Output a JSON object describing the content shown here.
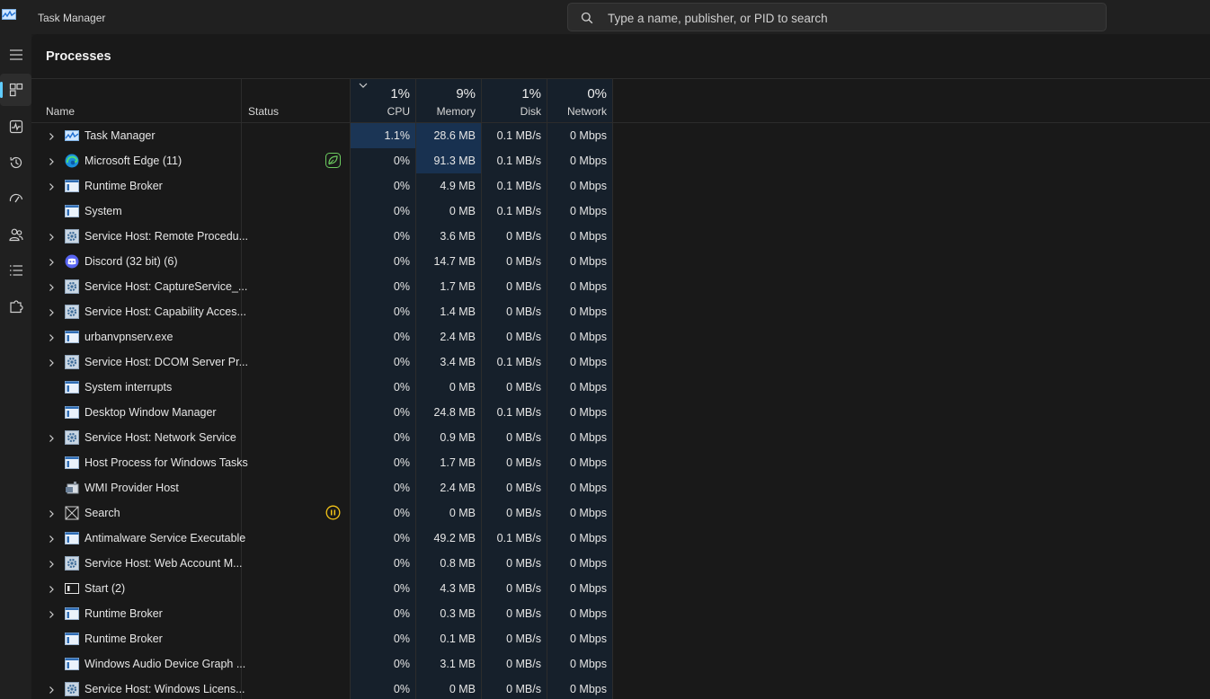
{
  "app": {
    "title": "Task Manager"
  },
  "search": {
    "placeholder": "Type a name, publisher, or PID to search"
  },
  "page": {
    "title": "Processes"
  },
  "columns": {
    "name": "Name",
    "status": "Status",
    "cpu": {
      "label": "CPU",
      "total": "1%"
    },
    "memory": {
      "label": "Memory",
      "total": "9%"
    },
    "disk": {
      "label": "Disk",
      "total": "1%"
    },
    "network": {
      "label": "Network",
      "total": "0%"
    }
  },
  "colors": {
    "accent": "#60cdff",
    "efficiency": "#6ccb5f",
    "paused": "#f5c518"
  },
  "processes": [
    {
      "name": "Task Manager",
      "icon": "task-manager-icon",
      "expandable": true,
      "status": "",
      "cpu": "1.1%",
      "memory": "28.6 MB",
      "disk": "0.1 MB/s",
      "network": "0 Mbps"
    },
    {
      "name": "Microsoft Edge (11)",
      "icon": "edge-icon",
      "expandable": true,
      "status": "efficiency-mode-icon",
      "cpu": "0%",
      "memory": "91.3 MB",
      "disk": "0.1 MB/s",
      "network": "0 Mbps"
    },
    {
      "name": "Runtime Broker",
      "icon": "window-app-icon",
      "expandable": true,
      "status": "",
      "cpu": "0%",
      "memory": "4.9 MB",
      "disk": "0.1 MB/s",
      "network": "0 Mbps"
    },
    {
      "name": "System",
      "icon": "window-app-icon",
      "expandable": false,
      "status": "",
      "cpu": "0%",
      "memory": "0 MB",
      "disk": "0.1 MB/s",
      "network": "0 Mbps"
    },
    {
      "name": "Service Host: Remote Procedu...",
      "icon": "service-gear-icon",
      "expandable": true,
      "status": "",
      "cpu": "0%",
      "memory": "3.6 MB",
      "disk": "0 MB/s",
      "network": "0 Mbps"
    },
    {
      "name": "Discord (32 bit) (6)",
      "icon": "discord-icon",
      "expandable": true,
      "status": "",
      "cpu": "0%",
      "memory": "14.7 MB",
      "disk": "0 MB/s",
      "network": "0 Mbps"
    },
    {
      "name": "Service Host: CaptureService_...",
      "icon": "service-gear-icon",
      "expandable": true,
      "status": "",
      "cpu": "0%",
      "memory": "1.7 MB",
      "disk": "0 MB/s",
      "network": "0 Mbps"
    },
    {
      "name": "Service Host: Capability Acces...",
      "icon": "service-gear-icon",
      "expandable": true,
      "status": "",
      "cpu": "0%",
      "memory": "1.4 MB",
      "disk": "0 MB/s",
      "network": "0 Mbps"
    },
    {
      "name": "urbanvpnserv.exe",
      "icon": "window-app-icon",
      "expandable": true,
      "status": "",
      "cpu": "0%",
      "memory": "2.4 MB",
      "disk": "0 MB/s",
      "network": "0 Mbps"
    },
    {
      "name": "Service Host: DCOM Server Pr...",
      "icon": "service-gear-icon",
      "expandable": true,
      "status": "",
      "cpu": "0%",
      "memory": "3.4 MB",
      "disk": "0.1 MB/s",
      "network": "0 Mbps"
    },
    {
      "name": "System interrupts",
      "icon": "window-app-icon",
      "expandable": false,
      "status": "",
      "cpu": "0%",
      "memory": "0 MB",
      "disk": "0 MB/s",
      "network": "0 Mbps"
    },
    {
      "name": "Desktop Window Manager",
      "icon": "window-app-icon",
      "expandable": false,
      "status": "",
      "cpu": "0%",
      "memory": "24.8 MB",
      "disk": "0.1 MB/s",
      "network": "0 Mbps"
    },
    {
      "name": "Service Host: Network Service",
      "icon": "service-gear-icon",
      "expandable": true,
      "status": "",
      "cpu": "0%",
      "memory": "0.9 MB",
      "disk": "0 MB/s",
      "network": "0 Mbps"
    },
    {
      "name": "Host Process for Windows Tasks",
      "icon": "window-app-icon",
      "expandable": false,
      "status": "",
      "cpu": "0%",
      "memory": "1.7 MB",
      "disk": "0 MB/s",
      "network": "0 Mbps"
    },
    {
      "name": "WMI Provider Host",
      "icon": "wmi-provider-icon",
      "expandable": false,
      "status": "",
      "cpu": "0%",
      "memory": "2.4 MB",
      "disk": "0 MB/s",
      "network": "0 Mbps"
    },
    {
      "name": "Search",
      "icon": "search-app-icon",
      "expandable": true,
      "status": "paused-icon",
      "cpu": "0%",
      "memory": "0 MB",
      "disk": "0 MB/s",
      "network": "0 Mbps"
    },
    {
      "name": "Antimalware Service Executable",
      "icon": "window-app-icon",
      "expandable": true,
      "status": "",
      "cpu": "0%",
      "memory": "49.2 MB",
      "disk": "0.1 MB/s",
      "network": "0 Mbps"
    },
    {
      "name": "Service Host: Web Account M...",
      "icon": "service-gear-icon",
      "expandable": true,
      "status": "",
      "cpu": "0%",
      "memory": "0.8 MB",
      "disk": "0 MB/s",
      "network": "0 Mbps"
    },
    {
      "name": "Start (2)",
      "icon": "start-app-icon",
      "expandable": true,
      "status": "",
      "cpu": "0%",
      "memory": "4.3 MB",
      "disk": "0 MB/s",
      "network": "0 Mbps"
    },
    {
      "name": "Runtime Broker",
      "icon": "window-app-icon",
      "expandable": true,
      "status": "",
      "cpu": "0%",
      "memory": "0.3 MB",
      "disk": "0 MB/s",
      "network": "0 Mbps"
    },
    {
      "name": "Runtime Broker",
      "icon": "window-app-icon",
      "expandable": false,
      "status": "",
      "cpu": "0%",
      "memory": "0.1 MB",
      "disk": "0 MB/s",
      "network": "0 Mbps"
    },
    {
      "name": "Windows Audio Device Graph ...",
      "icon": "window-app-icon",
      "expandable": false,
      "status": "",
      "cpu": "0%",
      "memory": "3.1 MB",
      "disk": "0 MB/s",
      "network": "0 Mbps"
    },
    {
      "name": "Service Host: Windows Licens...",
      "icon": "service-gear-icon",
      "expandable": true,
      "status": "",
      "cpu": "0%",
      "memory": "0 MB",
      "disk": "0 MB/s",
      "network": "0 Mbps"
    }
  ]
}
